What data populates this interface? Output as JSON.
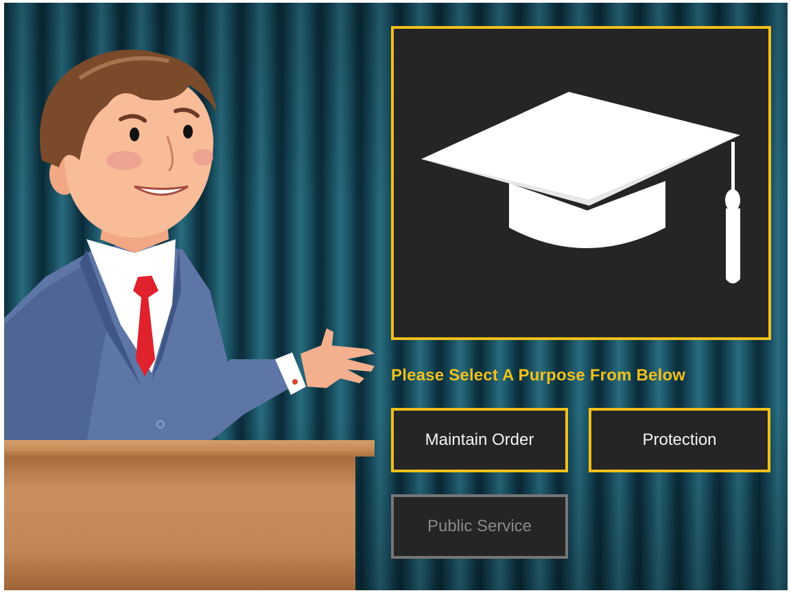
{
  "prompt": "Please Select A Purpose From Below",
  "image_panel": {
    "icon": "graduation-cap-icon"
  },
  "choices": [
    {
      "label": "Maintain Order",
      "enabled": true
    },
    {
      "label": "Protection",
      "enabled": true
    },
    {
      "label": "Public Service",
      "enabled": false
    }
  ],
  "colors": {
    "accent": "#f2c01a",
    "panel": "#252525",
    "disabled_border": "#767676",
    "curtain": "#123f4f"
  }
}
